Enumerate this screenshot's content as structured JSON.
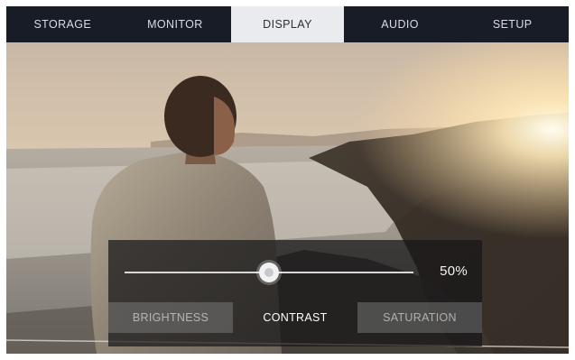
{
  "tabs": [
    {
      "label": "STORAGE",
      "active": false
    },
    {
      "label": "MONITOR",
      "active": false
    },
    {
      "label": "DISPLAY",
      "active": true
    },
    {
      "label": "AUDIO",
      "active": false
    },
    {
      "label": "SETUP",
      "active": false
    }
  ],
  "control": {
    "value_text": "50%",
    "value": 50
  },
  "modes": {
    "brightness": "BRIGHTNESS",
    "contrast": "CONTRAST",
    "saturation": "SATURATION",
    "selected": "contrast"
  },
  "colors": {
    "tabbar_bg": "#171c26",
    "tab_active_bg": "#e9ebee",
    "panel_bg": "#161618"
  }
}
